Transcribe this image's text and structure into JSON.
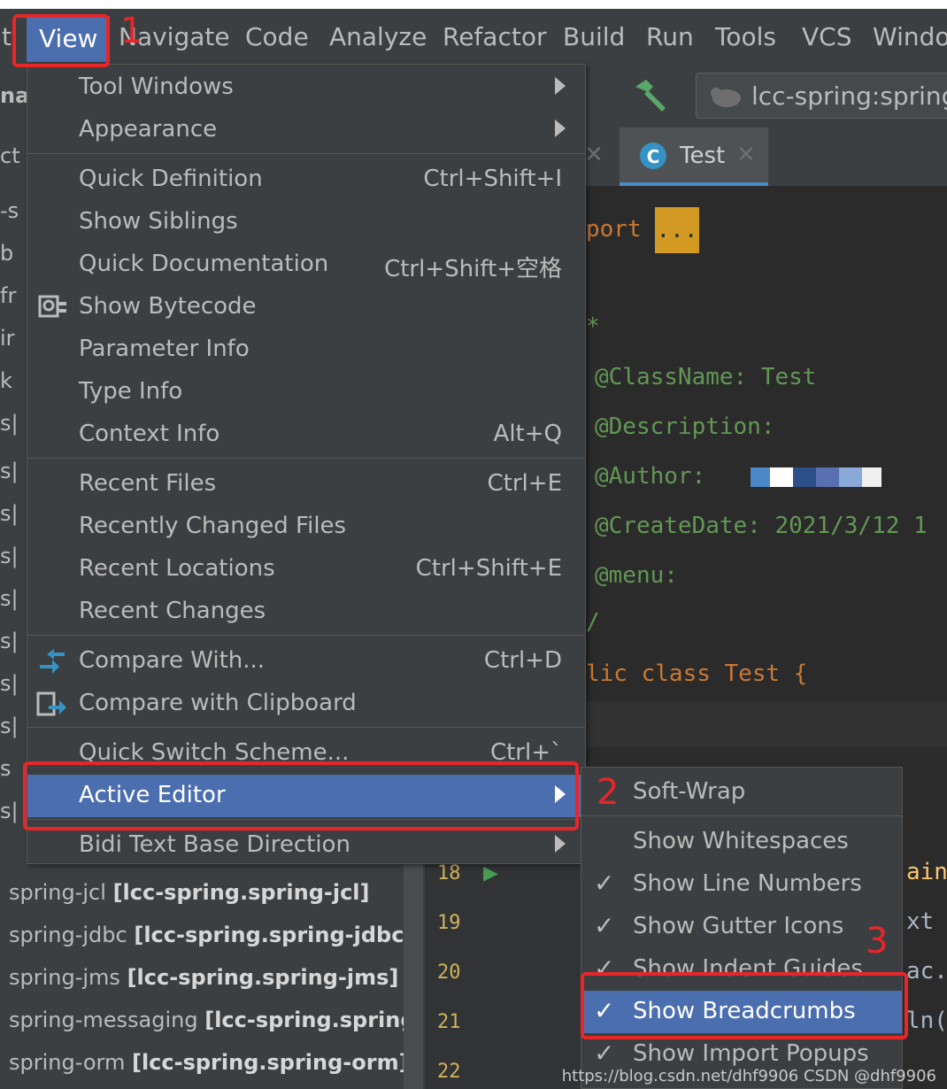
{
  "menubar": {
    "items": [
      "t",
      "View",
      "Navigate",
      "Code",
      "Analyze",
      "Refactor",
      "Build",
      "Run",
      "Tools",
      "VCS",
      "Windo"
    ]
  },
  "toolbar": {
    "run_config": "lcc-spring:spring-",
    "left_frag": "na"
  },
  "tabs": {
    "left_frag": "ct",
    "active_tab": "Test"
  },
  "project_tree": {
    "fragments": [
      "-s",
      "b",
      "fr",
      "ir",
      "k",
      "s|",
      "s|",
      "s|",
      "s|",
      "s|",
      "s|",
      "s|",
      "s|",
      "s",
      "s|"
    ],
    "items": [
      {
        "name": "spring-jcl",
        "module": "[lcc-spring.spring-jcl]"
      },
      {
        "name": "spring-jdbc",
        "module": "[lcc-spring.spring-jdbc]"
      },
      {
        "name": "spring-jms",
        "module": "[lcc-spring.spring-jms]"
      },
      {
        "name": "spring-messaging",
        "module": "[lcc-spring.spring"
      },
      {
        "name": "spring-orm",
        "module": "[lcc-spring.spring-orm]"
      }
    ]
  },
  "editor": {
    "lines": [
      {
        "text": "port",
        "kind": "kw"
      },
      {
        "text": "*",
        "kind": "doc"
      },
      {
        "text": "@ClassName: Test",
        "kind": "doc"
      },
      {
        "text": "@Description:",
        "kind": "doc"
      },
      {
        "text": "@Author:",
        "kind": "doc"
      },
      {
        "text": "@CreateDate: 2021/3/12 1",
        "kind": "doc"
      },
      {
        "text": "@menu:",
        "kind": "doc"
      },
      {
        "text": "/",
        "kind": "doc"
      },
      {
        "text": "lic class Test {",
        "kind": "code"
      }
    ],
    "folded": "...",
    "right_frags": [
      "ain",
      "xt",
      "ac.",
      "ln("
    ],
    "line_numbers": [
      "18",
      "19",
      "20",
      "21",
      "22"
    ]
  },
  "view_menu": {
    "items": [
      {
        "label": "Tool Windows",
        "shortcut": "",
        "submenu": true
      },
      {
        "label": "Appearance",
        "shortcut": "",
        "submenu": true
      },
      {
        "label": "Quick Definition",
        "shortcut": "Ctrl+Shift+I"
      },
      {
        "label": "Show Siblings",
        "shortcut": ""
      },
      {
        "label": "Quick Documentation",
        "shortcut": "Ctrl+Shift+空格"
      },
      {
        "label": "Show Bytecode",
        "shortcut": "",
        "icon": "bytecode-icon"
      },
      {
        "label": "Parameter Info",
        "shortcut": ""
      },
      {
        "label": "Type Info",
        "shortcut": ""
      },
      {
        "label": "Context Info",
        "shortcut": "Alt+Q"
      },
      {
        "label": "Recent Files",
        "shortcut": "Ctrl+E"
      },
      {
        "label": "Recently Changed Files",
        "shortcut": ""
      },
      {
        "label": "Recent Locations",
        "shortcut": "Ctrl+Shift+E"
      },
      {
        "label": "Recent Changes",
        "shortcut": ""
      },
      {
        "label": "Compare With...",
        "shortcut": "Ctrl+D",
        "icon": "compare-icon"
      },
      {
        "label": "Compare with Clipboard",
        "shortcut": "",
        "icon": "clipboard-compare-icon"
      },
      {
        "label": "Quick Switch Scheme...",
        "shortcut": "Ctrl+`"
      },
      {
        "label": "Active Editor",
        "shortcut": "",
        "submenu": true,
        "selected": true
      },
      {
        "label": "Bidi Text Base Direction",
        "shortcut": "",
        "submenu": true
      }
    ]
  },
  "active_editor_menu": {
    "items": [
      {
        "label": "Soft-Wrap",
        "checked": false
      },
      {
        "label": "Show Whitespaces",
        "checked": false
      },
      {
        "label": "Show Line Numbers",
        "checked": true
      },
      {
        "label": "Show Gutter Icons",
        "checked": true
      },
      {
        "label": "Show Indent Guides",
        "checked": true
      },
      {
        "label": "Show Breadcrumbs",
        "checked": true,
        "selected": true
      },
      {
        "label": "Show Import Popups",
        "checked": true
      }
    ]
  },
  "annotations": [
    "1",
    "2",
    "3"
  ],
  "watermark": "https://blog.csdn.net/dhf9906  CSDN @dhf9906",
  "colors": {
    "selection": "#4b6eaf",
    "annotation": "#e8262a",
    "menu_bg": "#3c3f41",
    "editor_bg": "#2b2b2b"
  }
}
